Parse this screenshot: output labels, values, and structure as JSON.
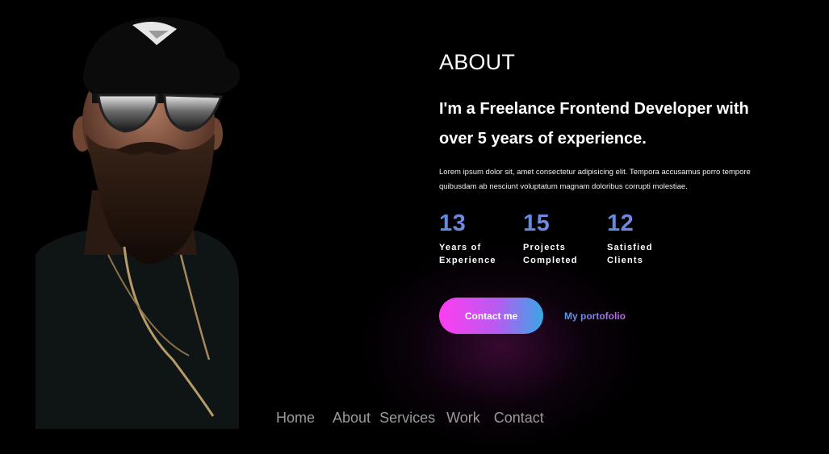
{
  "about": {
    "heading": "ABOUT",
    "headline_line1": "I'm a Freelance Frontend Developer with",
    "headline_line2": "over 5 years of experience.",
    "description": "Lorem ipsum dolor sit, amet consectetur adipisicing elit. Tempora accusamus porro tempore quibusdam ab nesciunt voluptatum magnam doloribus corrupti molestiae."
  },
  "stats": [
    {
      "number": "13",
      "label": "Years of\nExperience"
    },
    {
      "number": "15",
      "label": "Projects\nCompleted"
    },
    {
      "number": "12",
      "label": "Satisfied\nClients"
    }
  ],
  "actions": {
    "contact_label": "Contact me",
    "portfolio_label": "My portofolio"
  },
  "nav": {
    "home": "Home",
    "about": "About",
    "services": "Services",
    "work": "Work",
    "contact": "Contact"
  },
  "colors": {
    "background": "#000000",
    "accent_pink": "#ff3df0",
    "accent_blue": "#3aa6e6",
    "stat_gradient_start": "#5b8de0",
    "stat_gradient_end": "#b07ae4",
    "nav_text": "#9a9a9a"
  },
  "icons": {
    "portrait": "bearded-man-portrait-image"
  }
}
